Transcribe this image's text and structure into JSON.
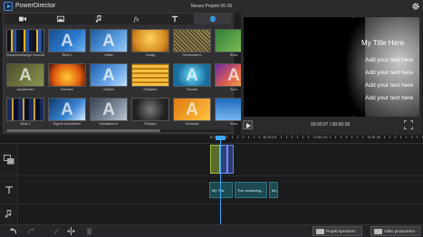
{
  "app": {
    "title": "PowerDirector",
    "project": "Neues Projekt 06-06"
  },
  "library": {
    "tabs": [
      {
        "icon": "video-camera-icon"
      },
      {
        "icon": "image-icon"
      },
      {
        "icon": "music-note-icon"
      },
      {
        "icon": "fx-icon"
      },
      {
        "icon": "text-title-icon"
      },
      {
        "icon": "particle-globe-icon",
        "active": true
      }
    ],
    "items": [
      {
        "label": "Schachbrettartige verschle...",
        "style": "bars"
      },
      {
        "label": "Blink 2",
        "style": "blue"
      },
      {
        "label": "Glitter",
        "style": "blueA"
      },
      {
        "label": "Goldig",
        "style": "gold"
      },
      {
        "label": "Schneesturm",
        "style": "noise"
      },
      {
        "label": "Scha",
        "style": "green"
      },
      {
        "label": "Ausblenden",
        "style": "fadeA"
      },
      {
        "label": "Brennen",
        "style": "fire"
      },
      {
        "label": "Glühen",
        "style": "glowA"
      },
      {
        "label": "Rollladen",
        "style": "stripes"
      },
      {
        "label": "Schalte",
        "style": "cyan"
      },
      {
        "label": "Schu",
        "style": "multiA"
      },
      {
        "label": "Blink 1",
        "style": "bars2"
      },
      {
        "label": "Eigene Aufnahmen",
        "style": "blue2"
      },
      {
        "label": "Kristallsterne",
        "style": "greyA"
      },
      {
        "label": "Rötegen",
        "style": "dark"
      },
      {
        "label": "Schrecke",
        "style": "orangeA"
      },
      {
        "label": "Scha",
        "style": "sky"
      }
    ]
  },
  "preview": {
    "title": "My Title Here",
    "lines": [
      "Add your text here",
      "Add your text here",
      "Add your text here",
      "Add your text here"
    ],
    "timecode": "00:00:07 / 00:00:38"
  },
  "timeline": {
    "ruler": [
      "00:00:00",
      "00:00:30",
      "00:01:00",
      "00:01:30"
    ],
    "text_clips": [
      "My Title",
      "The continuing...",
      "Mo"
    ]
  },
  "bottom": {
    "save_label": "Projekt speichern",
    "produce_label": "Video produzieren"
  }
}
